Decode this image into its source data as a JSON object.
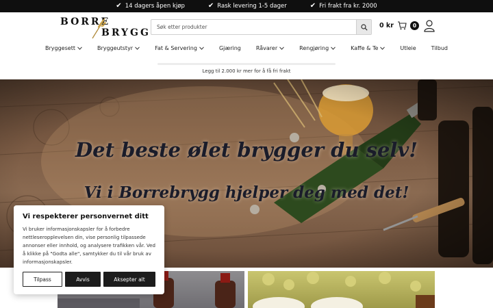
{
  "topbar": {
    "usps": [
      "14 dagers åpen kjøp",
      "Rask levering 1-5 dager",
      "Fri frakt fra kr. 2000"
    ]
  },
  "logo": {
    "line1": "BORRE",
    "line2": "BRYGG"
  },
  "search": {
    "placeholder": "Søk etter produkter",
    "icon": "search-icon"
  },
  "cart": {
    "total": "0 kr",
    "count": "0",
    "icon": "cart-icon"
  },
  "account": {
    "icon": "user-icon"
  },
  "nav": {
    "items": [
      {
        "label": "Bryggesett",
        "dropdown": true
      },
      {
        "label": "Bryggeutstyr",
        "dropdown": true
      },
      {
        "label": "Fat & Servering",
        "dropdown": true
      },
      {
        "label": "Gjæring",
        "dropdown": false
      },
      {
        "label": "Råvarer",
        "dropdown": true
      },
      {
        "label": "Rengjøring",
        "dropdown": true
      },
      {
        "label": "Kaffe & Te",
        "dropdown": true
      },
      {
        "label": "Utleie",
        "dropdown": false
      },
      {
        "label": "Tilbud",
        "dropdown": false
      }
    ]
  },
  "freeship": {
    "text": "Legg til 2.000 kr mer for å få fri frakt",
    "progress": 0
  },
  "hero": {
    "title": "Det beste ølet brygger du selv!",
    "subtitle": "Vi i Borrebrygg hjelper deg med det!"
  },
  "cookie": {
    "title": "Vi respekterer personvernet ditt",
    "text": "Vi bruker informasjonskapsler for å forbedre nettleseropplevelsen din, vise personlig tilpassede annonser eller innhold, og analysere trafikken vår. Ved å klikke på \"Godta alle\", samtykker du til vår bruk av informasjonskapsler.",
    "customize_label": "Tilpass",
    "reject_label": "Avvis",
    "accept_label": "Aksepter alt"
  },
  "colors": {
    "topbar": "#0f0f0f",
    "dark_button": "#1c1c1c",
    "hero_text": "#1a1c2a"
  }
}
